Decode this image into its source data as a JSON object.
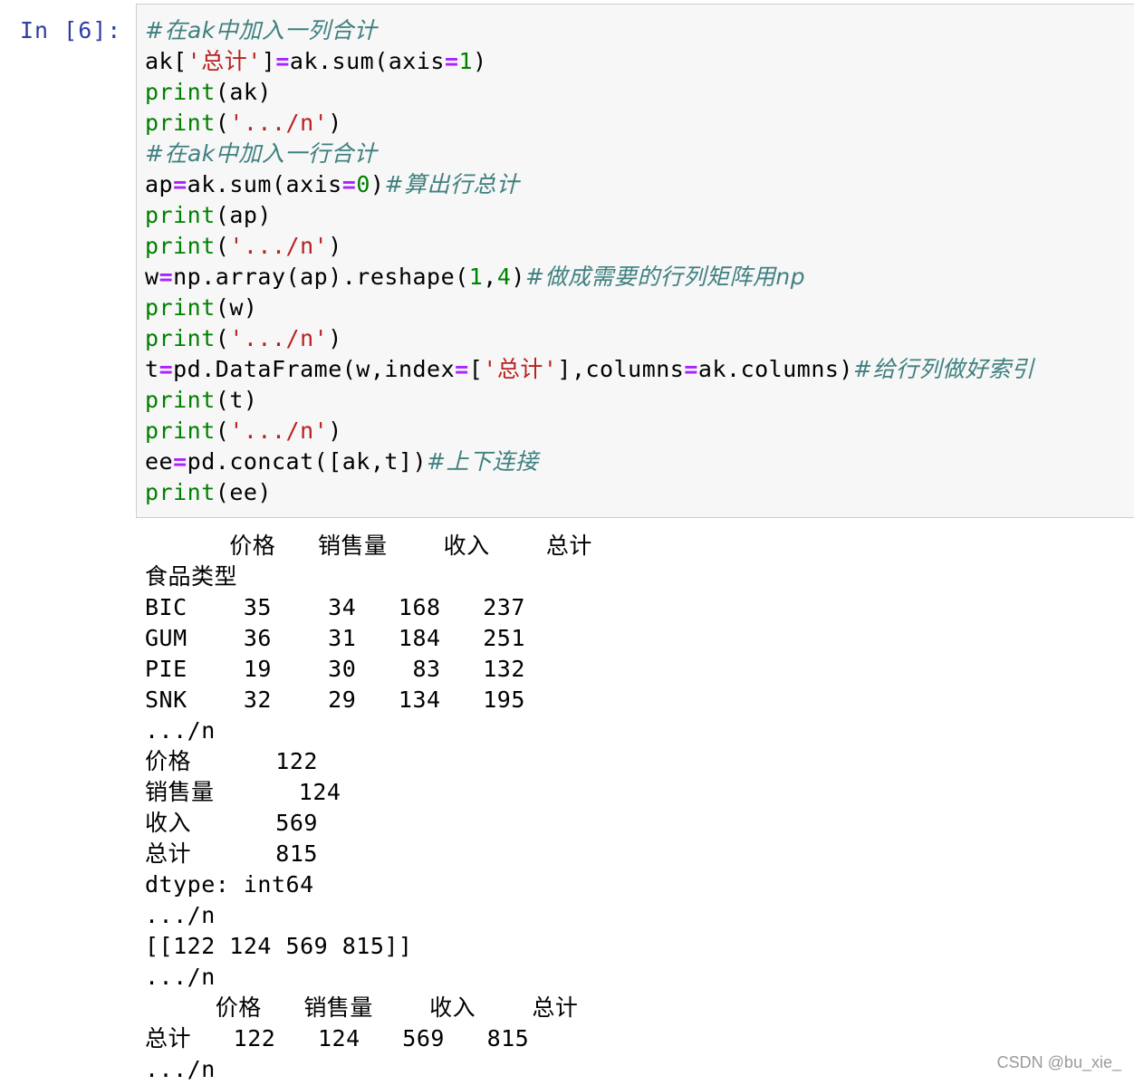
{
  "cell": {
    "prompt": "In [6]:",
    "code_lines": [
      [
        {
          "t": "#在ak中加入一列合计",
          "c": "cm"
        }
      ],
      [
        {
          "t": "ak[",
          "c": ""
        },
        {
          "t": "'总计'",
          "c": "str"
        },
        {
          "t": "]",
          "c": ""
        },
        {
          "t": "=",
          "c": "op"
        },
        {
          "t": "ak.sum(axis",
          "c": ""
        },
        {
          "t": "=",
          "c": "op"
        },
        {
          "t": "1",
          "c": "num"
        },
        {
          "t": ")",
          "c": ""
        }
      ],
      [
        {
          "t": "print",
          "c": "kw"
        },
        {
          "t": "(ak)",
          "c": ""
        }
      ],
      [
        {
          "t": "print",
          "c": "kw"
        },
        {
          "t": "(",
          "c": ""
        },
        {
          "t": "'.../n'",
          "c": "str"
        },
        {
          "t": ")",
          "c": ""
        }
      ],
      [
        {
          "t": "#在ak中加入一行合计",
          "c": "cm"
        }
      ],
      [
        {
          "t": "ap",
          "c": ""
        },
        {
          "t": "=",
          "c": "op"
        },
        {
          "t": "ak.sum(axis",
          "c": ""
        },
        {
          "t": "=",
          "c": "op"
        },
        {
          "t": "0",
          "c": "num"
        },
        {
          "t": ")",
          "c": ""
        },
        {
          "t": "#算出行总计",
          "c": "cm"
        }
      ],
      [
        {
          "t": "print",
          "c": "kw"
        },
        {
          "t": "(ap)",
          "c": ""
        }
      ],
      [
        {
          "t": "print",
          "c": "kw"
        },
        {
          "t": "(",
          "c": ""
        },
        {
          "t": "'.../n'",
          "c": "str"
        },
        {
          "t": ")",
          "c": ""
        }
      ],
      [
        {
          "t": "w",
          "c": ""
        },
        {
          "t": "=",
          "c": "op"
        },
        {
          "t": "np.array(ap).reshape(",
          "c": ""
        },
        {
          "t": "1",
          "c": "num"
        },
        {
          "t": ",",
          "c": ""
        },
        {
          "t": "4",
          "c": "num"
        },
        {
          "t": ")",
          "c": ""
        },
        {
          "t": "#做成需要的行列矩阵用np",
          "c": "cm"
        }
      ],
      [
        {
          "t": "print",
          "c": "kw"
        },
        {
          "t": "(w)",
          "c": ""
        }
      ],
      [
        {
          "t": "print",
          "c": "kw"
        },
        {
          "t": "(",
          "c": ""
        },
        {
          "t": "'.../n'",
          "c": "str"
        },
        {
          "t": ")",
          "c": ""
        }
      ],
      [
        {
          "t": "t",
          "c": ""
        },
        {
          "t": "=",
          "c": "op"
        },
        {
          "t": "pd.DataFrame(w,index",
          "c": ""
        },
        {
          "t": "=",
          "c": "op"
        },
        {
          "t": "[",
          "c": ""
        },
        {
          "t": "'总计'",
          "c": "str"
        },
        {
          "t": "],columns",
          "c": ""
        },
        {
          "t": "=",
          "c": "op"
        },
        {
          "t": "ak.columns)",
          "c": ""
        },
        {
          "t": "#给行列做好索引",
          "c": "cm"
        }
      ],
      [
        {
          "t": "print",
          "c": "kw"
        },
        {
          "t": "(t)",
          "c": ""
        }
      ],
      [
        {
          "t": "print",
          "c": "kw"
        },
        {
          "t": "(",
          "c": ""
        },
        {
          "t": "'.../n'",
          "c": "str"
        },
        {
          "t": ")",
          "c": ""
        }
      ],
      [
        {
          "t": "ee",
          "c": ""
        },
        {
          "t": "=",
          "c": "op"
        },
        {
          "t": "pd.concat([ak,t])",
          "c": ""
        },
        {
          "t": "#上下连接",
          "c": "cm"
        }
      ],
      [
        {
          "t": "print",
          "c": "kw"
        },
        {
          "t": "(ee)",
          "c": ""
        }
      ]
    ],
    "output_lines": [
      "      价格   销售量    收入    总计",
      "食品类型",
      "BIC    35    34   168   237",
      "GUM    36    31   184   251",
      "PIE    19    30    83   132",
      "SNK    32    29   134   195",
      ".../n",
      "价格      122",
      "销售量      124",
      "收入      569",
      "总计      815",
      "dtype: int64",
      ".../n",
      "[[122 124 569 815]]",
      ".../n",
      "     价格   销售量    收入    总计",
      "总计   122   124   569   815",
      ".../n"
    ]
  },
  "watermark": "CSDN @bu_xie_"
}
